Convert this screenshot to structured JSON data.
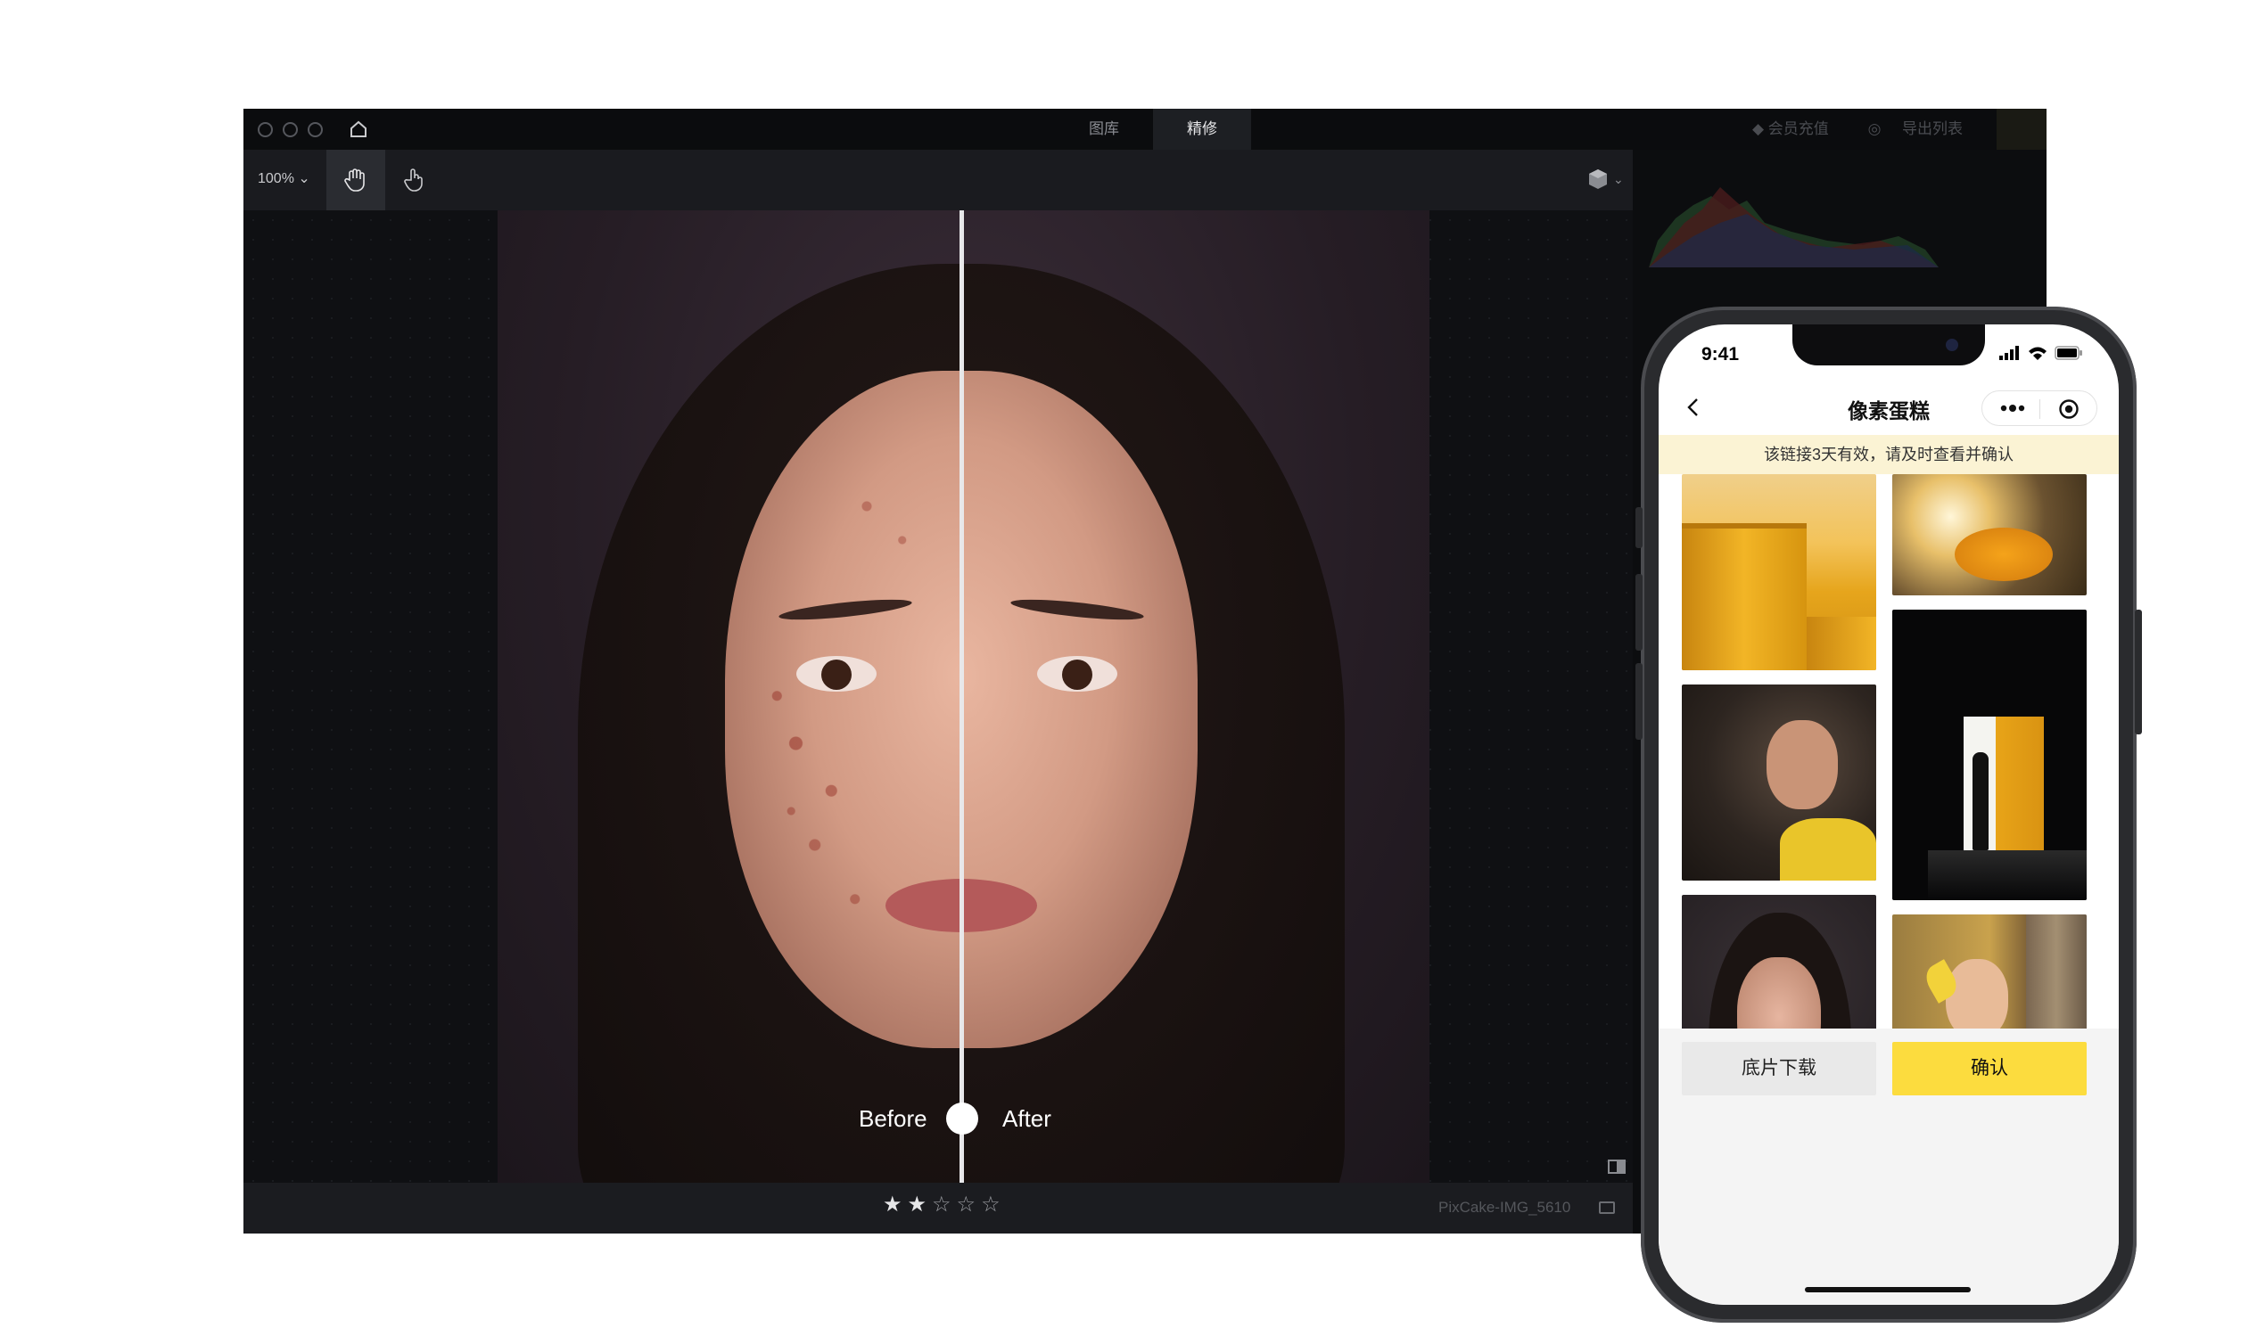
{
  "app": {
    "tabs": [
      {
        "label": "图库",
        "active": false
      },
      {
        "label": "精修",
        "active": true
      }
    ],
    "membership_label": "会员充值",
    "export_label": "导出列表",
    "zoom_level": "100%",
    "compare": {
      "before_label": "Before",
      "after_label": "After"
    },
    "rating": {
      "value": 2,
      "max": 5,
      "filled_glyph": "★",
      "empty_glyph": "☆"
    },
    "filename": "PixCake-IMG_5610"
  },
  "phone": {
    "time": "9:41",
    "title": "像素蛋糕",
    "banner": "该链接3天有效，请及时查看并确认",
    "download_label": "底片下载",
    "confirm_label": "确认"
  },
  "colors": {
    "accent_yellow": "#fcdc3e",
    "banner_bg": "#fbf3d4",
    "app_bg": "#131417"
  },
  "icons": [
    "home-icon",
    "hand-tool-icon",
    "pointer-hand-icon",
    "cube-icon",
    "compare-icon",
    "panel-icon",
    "back-chevron-icon",
    "more-dots-icon",
    "close-circle-icon",
    "signal-icon",
    "wifi-icon",
    "battery-icon"
  ]
}
